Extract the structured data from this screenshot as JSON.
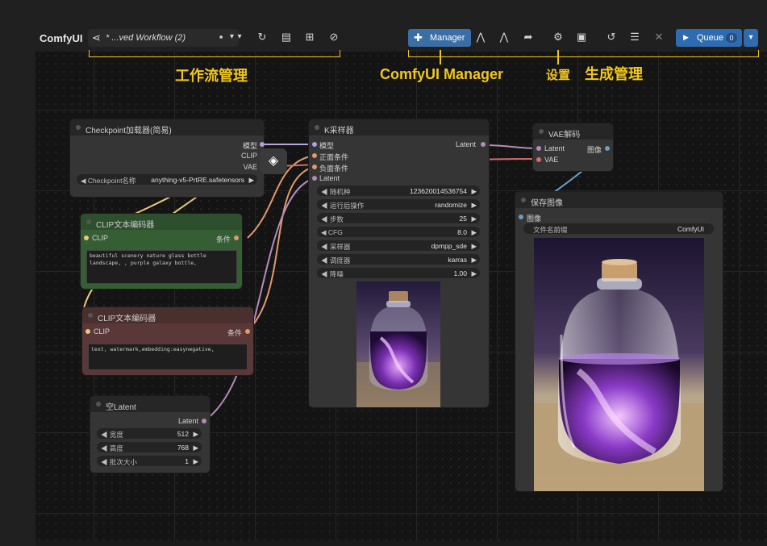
{
  "header": {
    "brand": "ComfyUI",
    "workflow_title": "* ...ved Workflow (2)",
    "manager_label": "Manager",
    "queue_label": "Queue",
    "queue_count": "0"
  },
  "annotations": {
    "workflow_mgmt": "工作流管理",
    "comfy_manager": "ComfyUI Manager",
    "settings": "设置",
    "generation_mgmt": "生成管理"
  },
  "nodes": {
    "checkpoint": {
      "title": "Checkpoint加载器(简易)",
      "out_model": "模型",
      "out_clip": "CLIP",
      "out_vae": "VAE",
      "ckpt_label": "Checkpoint名称",
      "ckpt_value": "anything-v5-PrtRE.safetensors"
    },
    "clip_pos": {
      "title": "CLIP文本编码器",
      "in_clip": "CLIP",
      "out_cond": "条件",
      "text": "beautiful scenery nature glass bottle landscape, , purple galaxy bottle,"
    },
    "clip_neg": {
      "title": "CLIP文本编码器",
      "in_clip": "CLIP",
      "out_cond": "条件",
      "text": "text, watermark,embedding:easynegative,"
    },
    "empty_latent": {
      "title": "空Latent",
      "out_latent": "Latent",
      "widgets": [
        {
          "label": "宽度",
          "value": "512"
        },
        {
          "label": "高度",
          "value": "768"
        },
        {
          "label": "批次大小",
          "value": "1"
        }
      ]
    },
    "ksampler": {
      "title": "K采样器",
      "in_model": "模型",
      "in_pos": "正面条件",
      "in_neg": "负面条件",
      "in_latent": "Latent",
      "out_latent": "Latent",
      "widgets": [
        {
          "label": "随机种",
          "value": "123620014536754"
        },
        {
          "label": "运行后操作",
          "value": "randomize"
        },
        {
          "label": "步数",
          "value": "25"
        },
        {
          "label": "CFG",
          "value": "8.0"
        },
        {
          "label": "采样器",
          "value": "dpmpp_sde"
        },
        {
          "label": "调度器",
          "value": "karras"
        },
        {
          "label": "降噪",
          "value": "1.00"
        }
      ]
    },
    "vae_decode": {
      "title": "VAE解码",
      "in_latent": "Latent",
      "in_vae": "VAE",
      "out_image": "图像"
    },
    "save_image": {
      "title": "保存图像",
      "in_image": "图像",
      "prefix_label": "文件名前缀",
      "prefix_value": "ComfyUI"
    }
  },
  "colors": {
    "accent": "#3a6ea5",
    "annotation": "#f2c81a",
    "model_link": "#b39ddb",
    "clip_link": "#ffd500",
    "cond_link": "#ffa931",
    "latent_link": "#ff9cf9",
    "vae_link": "#ff6e6e",
    "image_link": "#64b5f6"
  }
}
